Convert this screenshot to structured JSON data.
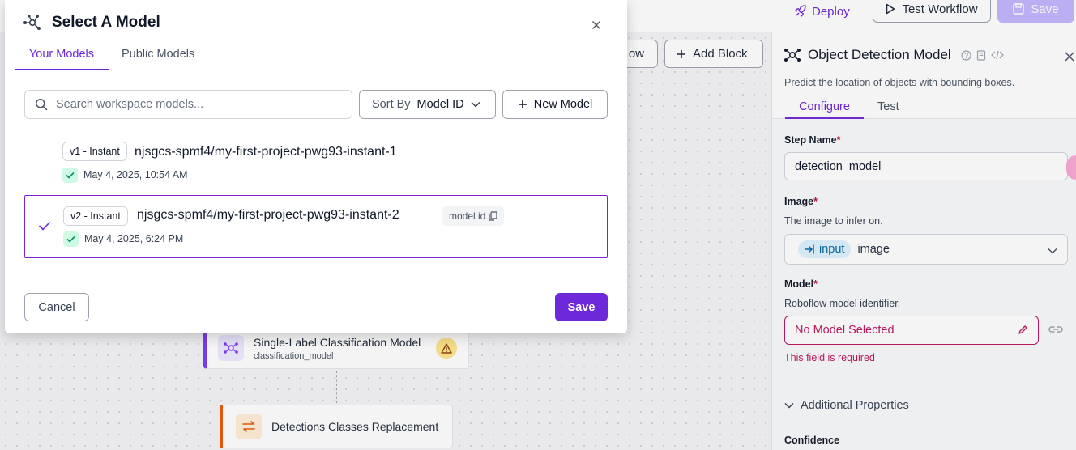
{
  "topbar": {
    "deploy_label": "Deploy",
    "test_workflow_label": "Test Workflow",
    "save_label": "Save"
  },
  "canvas": {
    "workflow_btn_label": "ow",
    "add_block_label": "Add Block",
    "nodes": [
      {
        "title": "Single-Label Classification Model",
        "subtitle": "classification_model",
        "icon": "model-graph-icon",
        "warning": true
      },
      {
        "title": "Detections Classes Replacement",
        "subtitle": "",
        "icon": "swap-arrows-icon",
        "warning": false
      }
    ]
  },
  "panel": {
    "title": "Object Detection Model",
    "description": "Predict the location of objects with bounding boxes.",
    "tabs": {
      "configure": "Configure",
      "test": "Test"
    },
    "step_name": {
      "label": "Step Name",
      "required_mark": "*",
      "value": "detection_model"
    },
    "image": {
      "label": "Image",
      "required_mark": "*",
      "help": "The image to infer on.",
      "chip": "input",
      "value": "image"
    },
    "model": {
      "label": "Model",
      "required_mark": "*",
      "help": "Roboflow model identifier.",
      "value": "No Model Selected",
      "error": "This field is required"
    },
    "additional_properties_label": "Additional Properties",
    "confidence_label": "Confidence"
  },
  "modal": {
    "title": "Select A Model",
    "tabs": {
      "your_models": "Your Models",
      "public_models": "Public Models"
    },
    "search": {
      "placeholder": "Search workspace models...",
      "value": ""
    },
    "sort": {
      "label": "Sort By",
      "value": "Model ID"
    },
    "new_model_label": "New Model",
    "models": [
      {
        "version": "v1 - Instant",
        "name": "njsgcs-spmf4/my-first-project-pwg93-instant-1",
        "date": "May 4, 2025, 10:54 AM",
        "selected": false
      },
      {
        "version": "v2 - Instant",
        "name": "njsgcs-spmf4/my-first-project-pwg93-instant-2",
        "date": "May 4, 2025, 6:24 PM",
        "selected": true,
        "id_chip": "model id"
      }
    ],
    "cancel_label": "Cancel",
    "save_label": "Save"
  },
  "colors": {
    "accent": "#6d28d9",
    "error": "#be185d",
    "success_bg": "#d1fae5",
    "success": "#059669"
  }
}
